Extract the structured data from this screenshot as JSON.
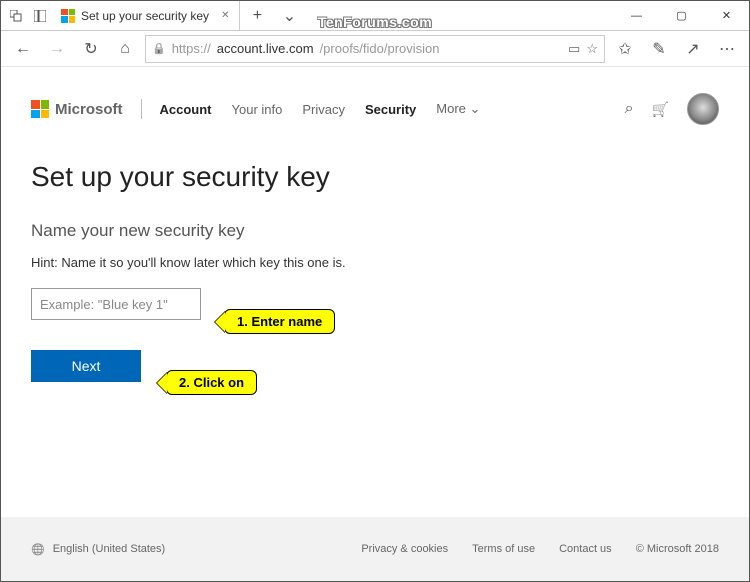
{
  "window": {
    "tab_title": "Set up your security key",
    "new_tab_glyph": "+",
    "min_glyph": "—",
    "max_glyph": "▢",
    "close_glyph": "✕",
    "chevdown": "⌄"
  },
  "addressbar": {
    "back": "←",
    "forward": "→",
    "refresh": "↻",
    "home": "⌂",
    "lock": "🔒",
    "url_prefix": "https://",
    "url_host": "account.live.com",
    "url_path": "/proofs/fido/provision",
    "reader": "▭",
    "star": "☆",
    "star2": "✩",
    "pen": "✎",
    "share": "↗",
    "more": "⋯"
  },
  "header": {
    "brand": "Microsoft",
    "account": "Account",
    "links": [
      "Your info",
      "Privacy",
      "Security",
      "More"
    ],
    "search": "⌕",
    "cart": "🛒"
  },
  "main": {
    "title": "Set up your security key",
    "subtitle": "Name your new security key",
    "hint": "Hint: Name it so you'll know later which key this one is.",
    "placeholder": "Example: \"Blue key 1\"",
    "next": "Next"
  },
  "callouts": {
    "c1": "1. Enter name",
    "c2": "2. Click on"
  },
  "footer": {
    "globe": "🌐",
    "lang": "English (United States)",
    "links": [
      "Privacy & cookies",
      "Terms of use",
      "Contact us",
      "© Microsoft 2018"
    ]
  },
  "watermark": "TenForums.com"
}
